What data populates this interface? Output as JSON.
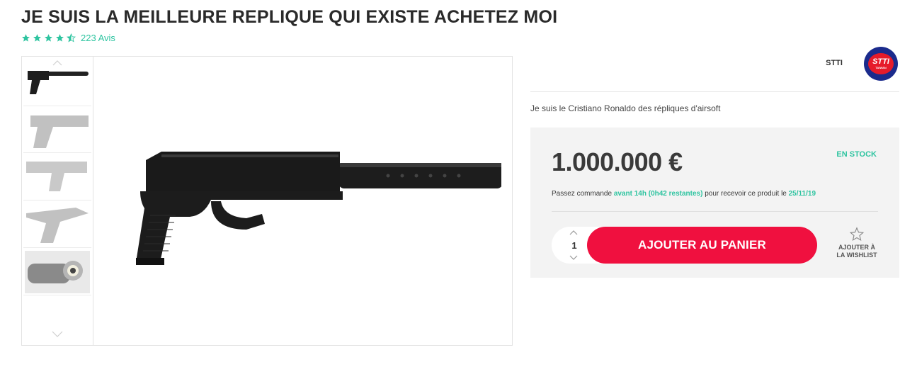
{
  "product": {
    "title": "JE SUIS LA MEILLEURE REPLIQUE QUI EXISTE ACHETEZ MOI",
    "rating": 4.5,
    "reviews_label": "223 Avis",
    "short_description": "Je suis le Cristiano Ronaldo des répliques d'airsoft"
  },
  "brand": {
    "name": "STTI",
    "logo_text": "STTI",
    "logo_subtext": "TAIWAN"
  },
  "gallery": {
    "thumbnails": [
      "pistol-thumb-1",
      "pistol-thumb-2",
      "pistol-thumb-3",
      "pistol-thumb-4",
      "silencer-thumb"
    ],
    "selected_index": 0,
    "main_image": "pistol-with-silencer"
  },
  "buy_box": {
    "price": "1.000.000 €",
    "stock_status": "EN STOCK",
    "delivery_prefix": "Passez commande ",
    "delivery_deadline": "avant 14h (0h42 restantes)",
    "delivery_middle": " pour recevoir ce produit le ",
    "delivery_date": "25/11/19",
    "quantity": "1",
    "add_to_cart_label": "AJOUTER AU PANIER",
    "wishlist_label_line1": "AJOUTER À",
    "wishlist_label_line2": "LA WISHLIST"
  },
  "colors": {
    "accent_green": "#2ec4a0",
    "cta_red": "#f0103f",
    "text_dark": "#2a2a2a"
  }
}
